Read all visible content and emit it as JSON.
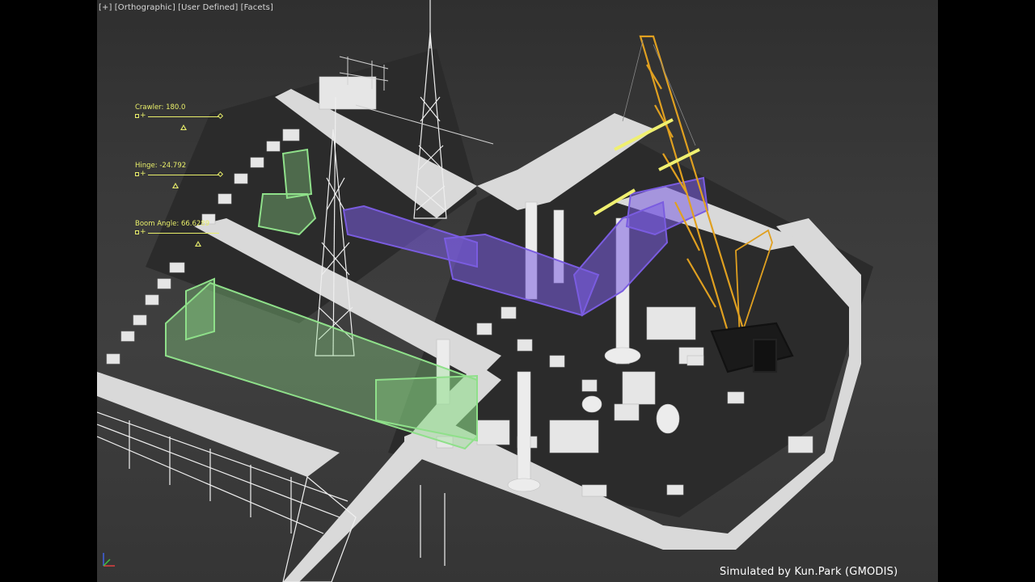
{
  "viewport": {
    "label_plus": "[+]",
    "label_view": "[Orthographic]",
    "label_shading": "[User Defined]",
    "label_style": "[Facets]"
  },
  "sliders": [
    {
      "label": "Crawler: 180.0",
      "position": 0.47
    },
    {
      "label": "Hinge: -24.792",
      "position": 0.38
    },
    {
      "label": "Boom Angle: 66.6289",
      "position": 0.7
    }
  ],
  "credit": "Simulated by Kun.Park (GMODIS)",
  "colors": {
    "background_top": "#2f2f2f",
    "ground": "#3a3a3a",
    "road": "#d9d9d9",
    "equipment": "#e6e6e6",
    "pipe_rack_green": "#8fe08a",
    "pipe_rack_purple": "#7a5ce0",
    "crane": "#e0a020",
    "slider_yellow": "#e9ef6a",
    "rigging_yellow": "#f0f070"
  },
  "icons": {
    "axis_gizmo": "axis-gizmo-icon",
    "slider_box": "square-icon",
    "slider_end": "diamond-icon",
    "slider_thumb": "triangle-icon"
  }
}
